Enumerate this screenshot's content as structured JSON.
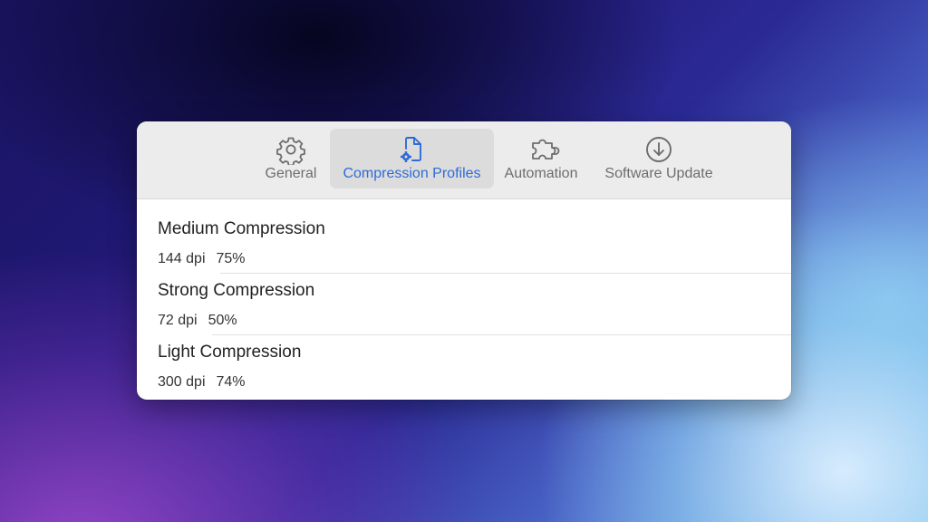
{
  "toolbar": {
    "tabs": [
      {
        "label": "General",
        "icon": "gear-icon",
        "active": false
      },
      {
        "label": "Compression Profiles",
        "icon": "document-gear-icon",
        "active": true
      },
      {
        "label": "Automation",
        "icon": "puzzle-piece-icon",
        "active": false
      },
      {
        "label": "Software Update",
        "icon": "download-circle-icon",
        "active": false
      }
    ]
  },
  "colors": {
    "accent": "#2f6bd7",
    "toolbar_bg": "#ececec",
    "active_tab_bg": "#dcdcdc",
    "inactive_label": "#6d6d6d"
  },
  "profiles": [
    {
      "name": "Medium Compression",
      "dpi": "144 dpi",
      "quality": "75%"
    },
    {
      "name": "Strong Compression",
      "dpi": "72 dpi",
      "quality": "50%"
    },
    {
      "name": "Light Compression",
      "dpi": "300 dpi",
      "quality": "74%"
    }
  ]
}
